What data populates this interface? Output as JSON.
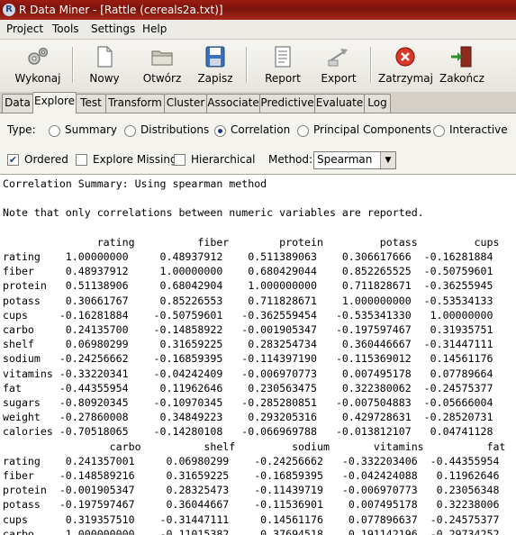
{
  "window": {
    "app_icon_letter": "R",
    "title": "R Data Miner - [Rattle (cereals2a.txt)]"
  },
  "menu": {
    "items": [
      "Project",
      "Tools",
      "Settings",
      "Help"
    ]
  },
  "toolbar": {
    "buttons": [
      {
        "label": "Wykonaj",
        "icon": "gears-icon"
      },
      {
        "label": "Nowy",
        "icon": "new-document-icon"
      },
      {
        "label": "Otwórz",
        "icon": "folder-open-icon"
      },
      {
        "label": "Zapisz",
        "icon": "floppy-save-icon"
      },
      {
        "label": "Report",
        "icon": "report-icon"
      },
      {
        "label": "Export",
        "icon": "export-icon"
      },
      {
        "label": "Zatrzymaj",
        "icon": "stop-icon"
      },
      {
        "label": "Zakończ",
        "icon": "quit-door-icon"
      }
    ]
  },
  "tabs": {
    "items": [
      "Data",
      "Explore",
      "Test",
      "Transform",
      "Cluster",
      "Associate",
      "Predictive",
      "Evaluate",
      "Log"
    ],
    "selected": "Explore"
  },
  "explore": {
    "type_label": "Type:",
    "types": [
      "Summary",
      "Distributions",
      "Correlation",
      "Principal Components",
      "Interactive"
    ],
    "selected_type": "Correlation",
    "ordered": {
      "label": "Ordered",
      "checked": true
    },
    "explore_missing": {
      "label": "Explore Missing",
      "checked": false
    },
    "hierarchical": {
      "label": "Hierarchical",
      "checked": false
    },
    "method_label": "Method:",
    "method_value": "Spearman"
  },
  "output": {
    "lines": [
      "Correlation Summary: Using spearman method",
      "",
      "Note that only correlations between numeric variables are reported.",
      "",
      "               rating          fiber        protein         potass         cups",
      "rating    1.00000000     0.48937912    0.511389063    0.306617666  -0.16281884",
      "fiber     0.48937912     1.00000000    0.680429044    0.852265525  -0.50759601",
      "protein   0.51138906     0.68042904    1.000000000    0.711828671  -0.36255945",
      "potass    0.30661767     0.85226553    0.711828671    1.000000000  -0.53534133",
      "cups     -0.16281884    -0.50759601   -0.362559454   -0.535341330   1.00000000",
      "carbo     0.24135700    -0.14858922   -0.001905347   -0.197597467   0.31935751",
      "shelf     0.06980299     0.31659225    0.283254734    0.360446667  -0.31447111",
      "sodium   -0.24256662    -0.16859395   -0.114397190   -0.115369012   0.14561176",
      "vitamins -0.33220341    -0.04242409   -0.006970773    0.007495178   0.07789664",
      "fat      -0.44355954     0.11962646    0.230563475    0.322380062  -0.24575377",
      "sugars   -0.80920345    -0.10970345   -0.285280851   -0.007504883  -0.05666004",
      "weight   -0.27860008     0.34849223    0.293205316    0.429728631  -0.28520731",
      "calories -0.70518065    -0.14280108   -0.066969788   -0.013812107   0.04741128",
      "                 carbo          shelf         sodium       vitamins          fat",
      "rating    0.241357001     0.06980299    -0.24256662   -0.332203406  -0.44355954",
      "fiber    -0.148589216     0.31659225    -0.16859395   -0.042424088   0.11962646",
      "protein  -0.001905347     0.28325473    -0.11439719   -0.006970773   0.23056348",
      "potass   -0.197597467     0.36044667    -0.11536901    0.007495178   0.32238006",
      "cups      0.319357510    -0.31447111     0.14561176    0.077896637  -0.24575377",
      "carbo     1.000000000    -0.11015382     0.37694518    0.191142196  -0.29734252"
    ]
  }
}
